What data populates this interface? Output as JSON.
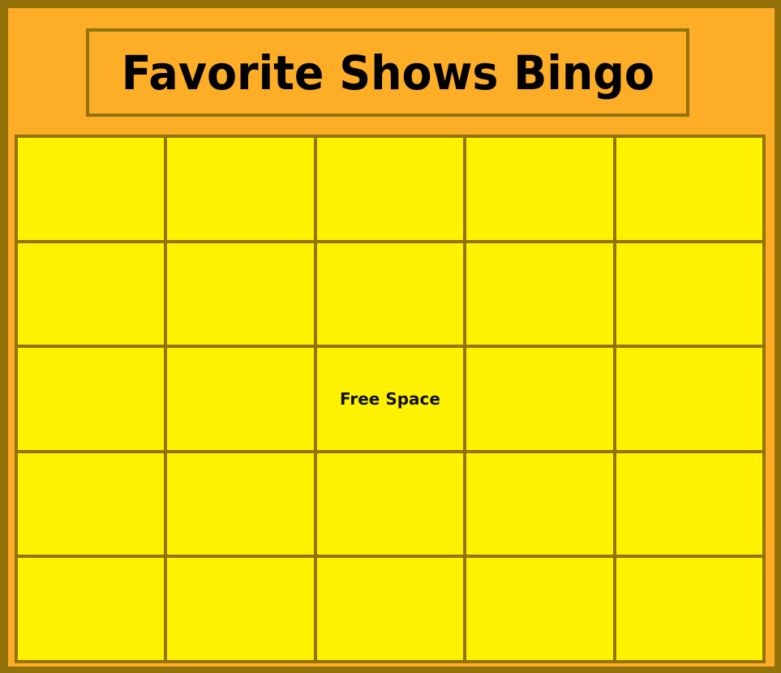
{
  "title": "Favorite Shows Bingo",
  "colors": {
    "border": "#937207",
    "background": "#FEAD27",
    "cell": "#FFF200",
    "text": "#000000"
  },
  "board": {
    "rows": [
      [
        "",
        "",
        "",
        "",
        ""
      ],
      [
        "",
        "",
        "",
        "",
        ""
      ],
      [
        "",
        "",
        "Free Space",
        "",
        ""
      ],
      [
        "",
        "",
        "",
        "",
        ""
      ],
      [
        "",
        "",
        "",
        "",
        ""
      ]
    ]
  }
}
